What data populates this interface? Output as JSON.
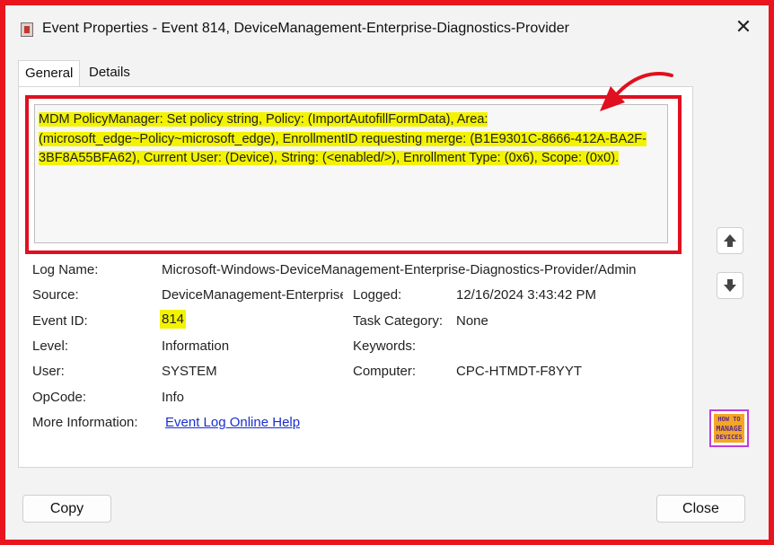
{
  "window": {
    "title": "Event Properties - Event 814, DeviceManagement-Enterprise-Diagnostics-Provider",
    "close_icon": "close-icon",
    "app_icon": "event-viewer-icon"
  },
  "tabs": [
    {
      "label": "General",
      "active": true
    },
    {
      "label": "Details",
      "active": false
    }
  ],
  "message": {
    "text": "MDM PolicyManager: Set policy string, Policy: (ImportAutofillFormData), Area: (microsoft_edge~Policy~microsoft_edge), EnrollmentID requesting merge: (B1E9301C-8666-412A-BA2F-3BF8A55BFA62), Current User: (Device), String: (<enabled/>), Enrollment Type: (0x6), Scope: (0x0)."
  },
  "fields": {
    "log_name": {
      "label": "Log Name:",
      "value": "Microsoft-Windows-DeviceManagement-Enterprise-Diagnostics-Provider/Admin"
    },
    "source": {
      "label": "Source:",
      "value": "DeviceManagement-Enterprise-Diagnostics-Provider"
    },
    "logged": {
      "label": "Logged:",
      "value": "12/16/2024 3:43:42 PM"
    },
    "event_id": {
      "label": "Event ID:",
      "value": "814"
    },
    "task_category": {
      "label": "Task Category:",
      "value": "None"
    },
    "level": {
      "label": "Level:",
      "value": "Information"
    },
    "keywords": {
      "label": "Keywords:",
      "value": ""
    },
    "user": {
      "label": "User:",
      "value": "SYSTEM"
    },
    "computer": {
      "label": "Computer:",
      "value": "CPC-HTMDT-F8YYT"
    },
    "opcode": {
      "label": "OpCode:",
      "value": "Info"
    },
    "more_info": {
      "label": "More Information:",
      "value": "Event Log Online Help"
    }
  },
  "nav": {
    "up_icon": "arrow-up-icon",
    "down_icon": "arrow-down-icon"
  },
  "logo": {
    "line1": "HOW TO",
    "line2": "MANAGE",
    "line3": "DEVICES"
  },
  "buttons": {
    "copy": "Copy",
    "close": "Close"
  },
  "colors": {
    "highlight": "#f3f300",
    "annotation_red": "#e0101f",
    "link": "#1a2fd0"
  }
}
